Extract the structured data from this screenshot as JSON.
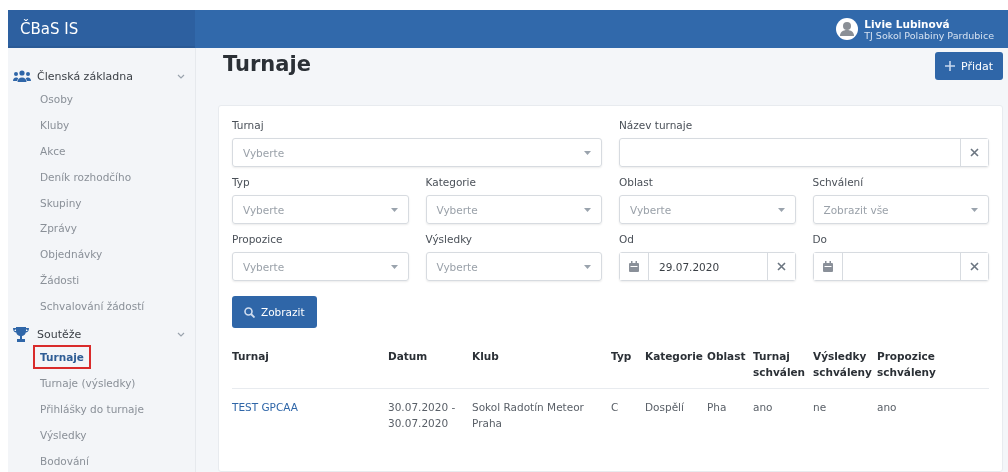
{
  "app": {
    "title": "ČBaS IS"
  },
  "user": {
    "name": "Livie Lubinová",
    "club": "TJ Sokol Polabiny Pardubice"
  },
  "sidebar": {
    "groups": [
      {
        "label": "Členská základna",
        "expanded": true,
        "items": [
          {
            "label": "Osoby",
            "selected": false
          },
          {
            "label": "Kluby",
            "selected": false
          },
          {
            "label": "Akce",
            "selected": false
          },
          {
            "label": "Deník rozhodčího",
            "selected": false
          },
          {
            "label": "Skupiny",
            "selected": false
          },
          {
            "label": "Zprávy",
            "selected": false
          },
          {
            "label": "Objednávky",
            "selected": false
          },
          {
            "label": "Žádosti",
            "selected": false
          },
          {
            "label": "Schvalování žádostí",
            "selected": false
          }
        ]
      },
      {
        "label": "Soutěže",
        "expanded": true,
        "items": [
          {
            "label": "Turnaje",
            "selected": true
          },
          {
            "label": "Turnaje (výsledky)",
            "selected": false
          },
          {
            "label": "Přihlášky do turnaje",
            "selected": false
          },
          {
            "label": "Výsledky",
            "selected": false
          },
          {
            "label": "Bodování",
            "selected": false
          }
        ]
      }
    ]
  },
  "page": {
    "title": "Turnaje",
    "add_button": "Přidat"
  },
  "filters": [
    {
      "kind": "select",
      "label": "Turnaj",
      "placeholder": "Vyberte",
      "wide": true
    },
    {
      "kind": "text",
      "label": "Název turnaje",
      "wide": true
    },
    {
      "kind": "select",
      "label": "Typ",
      "placeholder": "Vyberte",
      "wide": false
    },
    {
      "kind": "select",
      "label": "Kategorie",
      "placeholder": "Vyberte",
      "wide": false
    },
    {
      "kind": "select",
      "label": "Oblast",
      "placeholder": "Vyberte",
      "wide": false
    },
    {
      "kind": "select",
      "label": "Schválení",
      "placeholder": "Zobrazit vše",
      "wide": false
    },
    {
      "kind": "select",
      "label": "Propozice",
      "placeholder": "Vyberte",
      "wide": false
    },
    {
      "kind": "select",
      "label": "Výsledky",
      "placeholder": "Vyberte",
      "wide": false
    },
    {
      "kind": "date",
      "label": "Od",
      "value": "29.07.2020",
      "wide": false
    },
    {
      "kind": "date",
      "label": "Do",
      "wide": false
    }
  ],
  "search_button": "Zobrazit",
  "table": {
    "columns": [
      "Turnaj",
      "Datum",
      "Klub",
      "Typ",
      "Kategorie",
      "Oblast",
      "Turnaj schválen",
      "Výsledky schváleny",
      "Propozice schváleny"
    ],
    "rows": [
      [
        "TEST GPCAA",
        "30.07.2020 - 30.07.2020",
        "Sokol Radotín Meteor Praha",
        "C",
        "Dospělí",
        "Pha",
        "ano",
        "ne",
        "ano"
      ]
    ]
  }
}
